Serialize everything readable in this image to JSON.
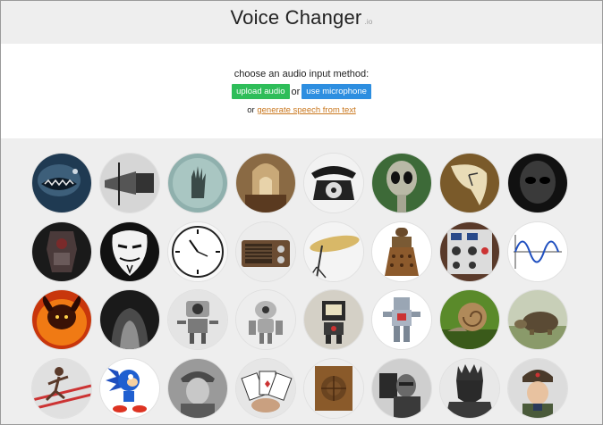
{
  "header": {
    "title": "Voice Changer",
    "suffix": ".io"
  },
  "input": {
    "prompt": "choose an audio input method:",
    "upload_label": "upload audio",
    "or_label": "or",
    "mic_label": "use microphone",
    "tts_prefix": "or",
    "tts_link": "generate speech from text"
  },
  "voices": [
    {
      "icon": "monster-icon"
    },
    {
      "icon": "megaphone-icon"
    },
    {
      "icon": "ghost-hand-icon"
    },
    {
      "icon": "cathedral-icon"
    },
    {
      "icon": "telephone-icon"
    },
    {
      "icon": "alien-icon"
    },
    {
      "icon": "melting-clock-icon"
    },
    {
      "icon": "dark-alien-icon"
    },
    {
      "icon": "mech-warrior-icon"
    },
    {
      "icon": "anonymous-mask-icon"
    },
    {
      "icon": "reversed-clock-icon"
    },
    {
      "icon": "radio-icon"
    },
    {
      "icon": "cymbal-icon"
    },
    {
      "icon": "dalek-icon"
    },
    {
      "icon": "synth-module-icon"
    },
    {
      "icon": "sine-wave-icon"
    },
    {
      "icon": "fire-demon-icon"
    },
    {
      "icon": "cave-icon"
    },
    {
      "icon": "robot-icon"
    },
    {
      "icon": "robot-icon"
    },
    {
      "icon": "tv-robot-icon"
    },
    {
      "icon": "toy-robot-icon"
    },
    {
      "icon": "snail-icon"
    },
    {
      "icon": "tortoise-icon"
    },
    {
      "icon": "runner-icon"
    },
    {
      "icon": "sonic-icon"
    },
    {
      "icon": "old-man-icon"
    },
    {
      "icon": "cards-icon"
    },
    {
      "icon": "wooden-speaker-icon"
    },
    {
      "icon": "stephen-hawking-icon"
    },
    {
      "icon": "dark-lord-icon"
    },
    {
      "icon": "russian-soldier-icon"
    }
  ]
}
